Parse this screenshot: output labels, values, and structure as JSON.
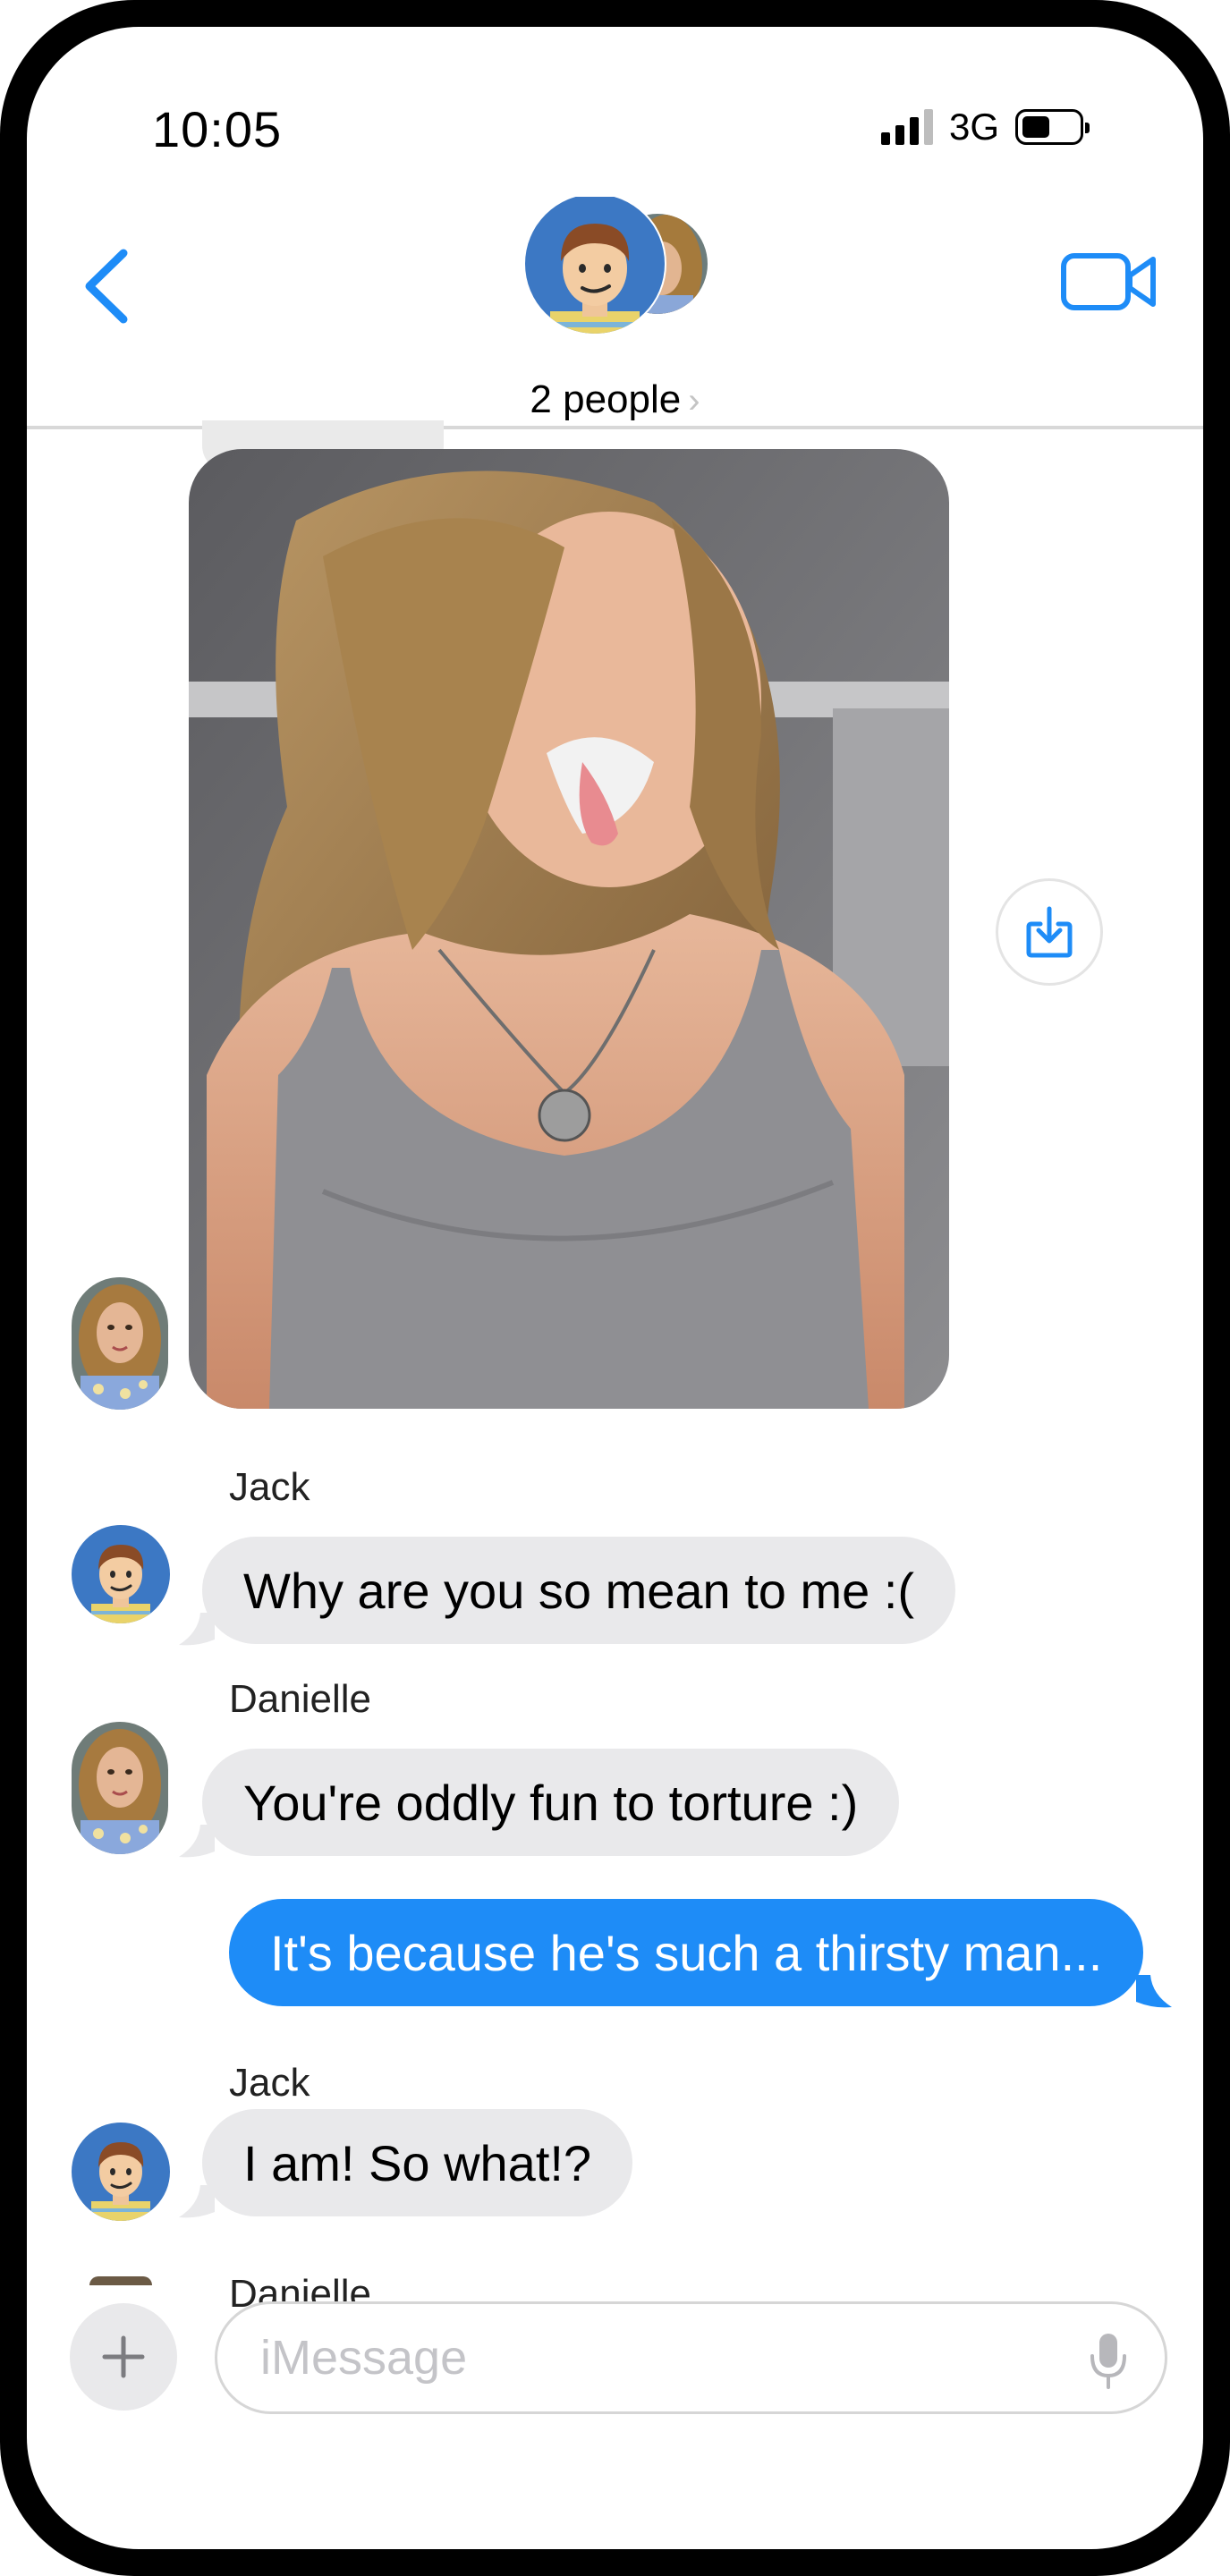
{
  "status_bar": {
    "time": "10:05",
    "network": "3G"
  },
  "header": {
    "group_caption": "2 people",
    "chevron": "›",
    "icons": [
      "back-chevron-icon",
      "video-camera-icon"
    ]
  },
  "messages": [
    {
      "type": "photo",
      "sender": "Danielle",
      "save_icon": "download-icon"
    },
    {
      "type": "incoming",
      "sender": "Jack",
      "text": "Why are you so mean to me :("
    },
    {
      "type": "incoming",
      "sender": "Danielle",
      "text": "You're oddly fun to torture :)"
    },
    {
      "type": "outgoing",
      "text": "It's because he's such a thirsty man..."
    },
    {
      "type": "incoming",
      "sender": "Jack",
      "text": "I am!  So what!?"
    },
    {
      "type": "incoming",
      "sender": "Danielle",
      "text": ""
    }
  ],
  "composer": {
    "placeholder": "iMessage",
    "plus_icon": "plus-icon",
    "mic_icon": "microphone-icon"
  },
  "colors": {
    "accent": "#1e8cf7",
    "incoming_bubble": "#e9e9eb",
    "jack_avatar_bg": "#3c78c4"
  }
}
